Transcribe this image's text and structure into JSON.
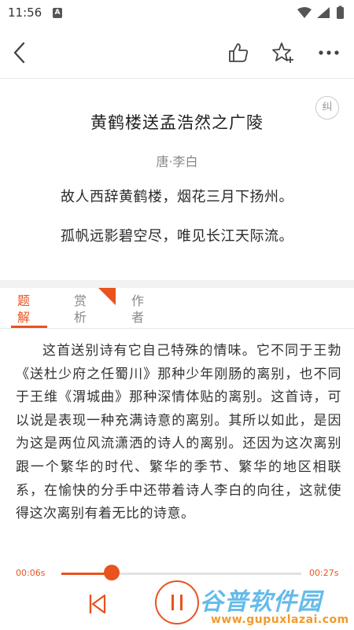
{
  "status_bar": {
    "time": "11:56",
    "notification_letter": "A",
    "icons": [
      "wifi-icon",
      "signal-icon",
      "battery-icon"
    ]
  },
  "app_bar": {
    "icons": [
      "back-icon",
      "thumbs-up-icon",
      "star-plus-icon",
      "more-icon"
    ]
  },
  "poem": {
    "title": "黄鹤楼送孟浩然之广陵",
    "author": "唐·李白",
    "lines": [
      "故人西辞黄鹤楼，烟花三月下扬州。",
      "孤帆远影碧空尽，唯见长江天际流。"
    ],
    "correct_label": "纠"
  },
  "tabs": [
    {
      "label": "题解",
      "active": true
    },
    {
      "label": "赏析",
      "active": false
    },
    {
      "label": "作者",
      "active": false
    }
  ],
  "article": {
    "text": "这首送别诗有它自己特殊的情味。它不同于王勃《送杜少府之任蜀川》那种少年刚肠的离别，也不同于王维《渭城曲》那种深情体贴的离别。这首诗，可以说是表现一种充满诗意的离别。其所以如此，是因为这是两位风流潇洒的诗人的离别。还因为这次离别跟一个繁华的时代、繁华的季节、繁华的地区相联系，在愉快的分手中还带着诗人李白的向往，这就使得这次离别有着无比的诗意。"
  },
  "player": {
    "current_time": "00:06s",
    "total_time": "00:27s",
    "progress": 0.21,
    "state": "playing"
  },
  "watermark": {
    "brand": "谷普软件园",
    "url": "www.gupuxlazai.com"
  },
  "colors": {
    "accent": "#e8531e",
    "text": "#333333",
    "muted": "#888888"
  }
}
